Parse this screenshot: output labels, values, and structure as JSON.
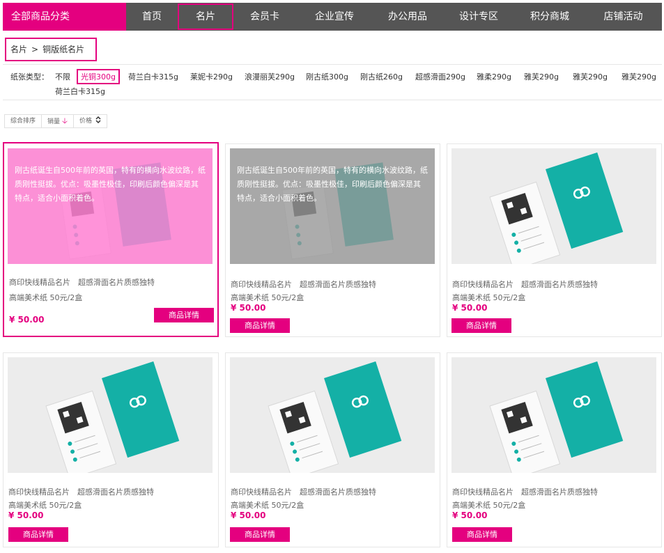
{
  "nav": {
    "category_button": "全部商品分类",
    "items": [
      {
        "label": "首页"
      },
      {
        "label": "名片"
      },
      {
        "label": "会员卡"
      },
      {
        "label": "企业宣传"
      },
      {
        "label": "办公用品"
      },
      {
        "label": "设计专区"
      },
      {
        "label": "积分商城"
      },
      {
        "label": "店铺活动"
      }
    ],
    "active_item": "名片"
  },
  "breadcrumb": {
    "items": [
      "名片",
      "铜版纸名片"
    ],
    "separator": ">"
  },
  "filter": {
    "label": "纸张类型：",
    "options": [
      "不限",
      "光铜300g",
      "荷兰白卡315g",
      "莱妮卡290g",
      "浪漫丽芙290g",
      "刚古纸300g",
      "刚古纸260g",
      "超感滑面290g",
      "雅柔290g",
      "雅芙290g",
      "雅芙290g",
      "雅芙290g",
      "荷兰白卡315g"
    ],
    "selected": "光铜300g"
  },
  "sort": {
    "comprehensive": "综合排序",
    "sales": "销量",
    "price": "价格",
    "sales_arrow": "down-arrow-icon",
    "price_arrow": "updown-icon"
  },
  "products": [
    {
      "title": "商印快线精品名片　超感滑面名片质感独特",
      "spec": "高端美术纸 50元/2盒",
      "price": "¥ 50.00",
      "button": "商品详情",
      "overlay": "刚古纸诞生自500年前的英国，特有的横向水波纹路，纸质刚性挺拔。优点：吸墨性极佳，印刷后颜色偏深是其特点，适合小面积着色。",
      "overlay_style": "pink",
      "highlighted": true
    },
    {
      "title": "商印快线精品名片　超感滑面名片质感独特",
      "spec": "高端美术纸 50元/2盒",
      "price": "¥ 50.00",
      "button": "商品详情",
      "overlay": "刚古纸诞生自500年前的英国，特有的横向水波纹路，纸质刚性挺拔。优点：吸墨性极佳，印刷后颜色偏深是其特点，适合小面积着色。",
      "overlay_style": "gray",
      "highlighted": false
    },
    {
      "title": "商印快线精品名片　超感滑面名片质感独特",
      "spec": "高端美术纸 50元/2盒",
      "price": "¥ 50.00",
      "button": "商品详情",
      "overlay": "",
      "overlay_style": "none",
      "highlighted": false
    },
    {
      "title": "商印快线精品名片　超感滑面名片质感独特",
      "spec": "高端美术纸 50元/2盒",
      "price": "¥ 50.00",
      "button": "商品详情",
      "overlay": "",
      "overlay_style": "none",
      "highlighted": false
    },
    {
      "title": "商印快线精品名片　超感滑面名片质感独特",
      "spec": "高端美术纸 50元/2盒",
      "price": "¥ 50.00",
      "button": "商品详情",
      "overlay": "",
      "overlay_style": "none",
      "highlighted": false
    },
    {
      "title": "商印快线精品名片　超感滑面名片质感独特",
      "spec": "高端美术纸 50元/2盒",
      "price": "¥ 50.00",
      "button": "商品详情",
      "overlay": "",
      "overlay_style": "none",
      "highlighted": false
    }
  ],
  "colors": {
    "accent": "#e4007f",
    "nav_bg": "#555555",
    "card_teal": "#14b0a6"
  }
}
